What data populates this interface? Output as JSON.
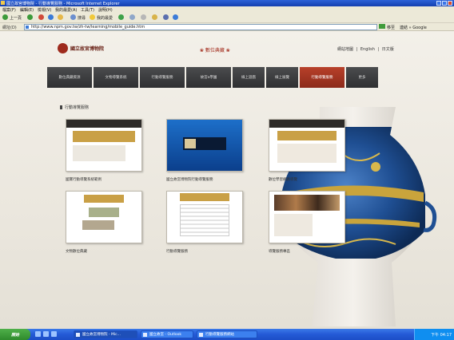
{
  "window": {
    "title": "國立故宮博物院 - 行動導覽服務 - Microsoft Internet Explorer"
  },
  "menubar": {
    "items": [
      "檔案(F)",
      "編輯(E)",
      "檢視(V)",
      "我的最愛(A)",
      "工具(T)",
      "說明(H)"
    ]
  },
  "toolbar": {
    "back_label": "上一頁",
    "search_label": "搜尋",
    "favorites_label": "我的最愛"
  },
  "addressbar": {
    "label": "網址(D)",
    "url": "http://www.npm.gov.tw/zh-tw/learning/mobile_guide.htm",
    "go_label": "移至",
    "links_label": "連結 » Google"
  },
  "site": {
    "logo_text": "國立故宮博物院",
    "header_center": "❀ 數位典藏 ❀",
    "header_links": "網站地圖 | English | 日文版",
    "nav": [
      {
        "label": "數位典藏資源",
        "active": false
      },
      {
        "label": "文物導覽系統",
        "active": false
      },
      {
        "label": "行動導覽服務",
        "active": false
      },
      {
        "label": "故宮e學園",
        "active": false
      },
      {
        "label": "線上遊戲",
        "active": false
      },
      {
        "label": "線上展覽",
        "active": false
      },
      {
        "label": "行動導覽服務",
        "active": true
      },
      {
        "label": "更多",
        "active": false
      }
    ],
    "section_title": "行動導覽服務",
    "cards": [
      {
        "caption": "國寶行動導覽系統範例"
      },
      {
        "caption": "國立故宮博物院行動導覽服務"
      },
      {
        "caption": "數位學習網路導覽"
      },
      {
        "caption": "文物數位典藏"
      },
      {
        "caption": "行動導覽服務"
      },
      {
        "caption": "導覽服務專區"
      }
    ]
  },
  "taskbar": {
    "start_label": "開始",
    "tasks": [
      "國立故宮博物院 - Mic...",
      "國立故宮 - Outlook",
      "行動導覽服務網站"
    ],
    "clock": "下午 04:17"
  },
  "colors": {
    "accent_red": "#9e2b1d",
    "nav_dark": "#3a3b3d",
    "nav_active": "#b8402a",
    "xp_blue": "#245ad6"
  }
}
